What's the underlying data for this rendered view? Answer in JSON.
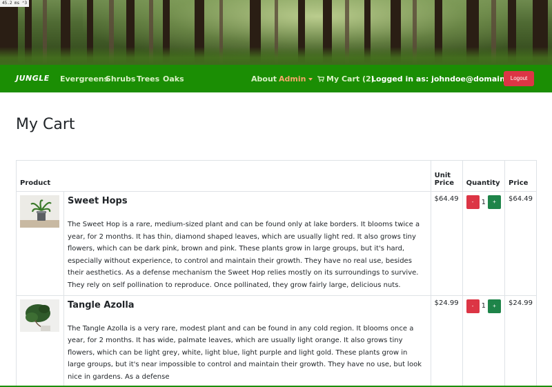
{
  "timing_badge": "45.2 ms ⌃3",
  "navbar": {
    "brand": "JUNGLE",
    "links": [
      "Evergreens",
      "Shrubs",
      "Trees",
      "Oaks"
    ],
    "about": "About",
    "admin": "Admin",
    "cart": "My Cart (2)",
    "logged_in": "Logged in as: johndoe@domain.com",
    "logout": "Logout"
  },
  "page": {
    "title": "My Cart"
  },
  "table": {
    "headers": {
      "product": "Product",
      "unit_price": "Unit Price",
      "quantity": "Quantity",
      "price": "Price"
    },
    "rows": [
      {
        "name": "Sweet Hops",
        "description": "The Sweet Hop is a rare, medium-sized plant and can be found only at lake borders. It blooms twice a year, for 2 months. It has thin, diamond shaped leaves, which are usually light red. It also grows tiny flowers, which can be dark pink, brown and pink. These plants grow in large groups, but it's hard, especially without experience, to control and maintain their growth. They have no real use, besides their aesthetics. As a defense mechanism the Sweet Hop relies mostly on its surroundings to survive. They rely on self pollination to reproduce. Once pollinated, they grow fairly large, delicious nuts.",
        "unit_price": "$64.49",
        "minus": "-",
        "quantity": "1",
        "plus": "+",
        "price": "$64.49"
      },
      {
        "name": "Tangle Azolla",
        "description": "The Tangle Azolla is a very rare, modest plant and can be found in any cold region. It blooms once a year, for 2 months. It has wide, palmate leaves, which are usually light orange. It also grows tiny flowers, which can be light grey, white, light blue, light purple and light gold. These plants grow in large groups, but it's near impossible to control and maintain their growth. They have no use, but look nice in gardens. As a defense",
        "unit_price": "$24.99",
        "minus": "-",
        "quantity": "1",
        "plus": "+",
        "price": "$24.99"
      }
    ]
  },
  "colors": {
    "navbar": "#1b8e04",
    "danger": "#dc3545",
    "success": "#1e8449",
    "admin": "#f7a76a"
  }
}
